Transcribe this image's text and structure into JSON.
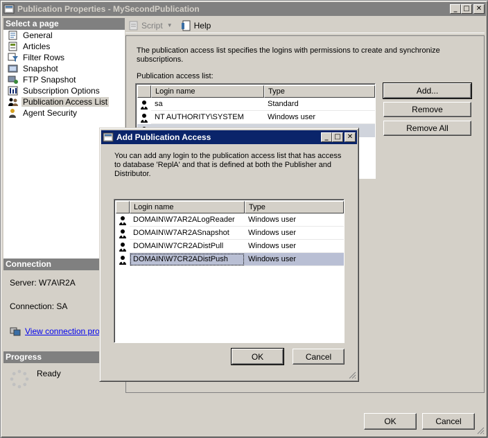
{
  "main_window": {
    "title": "Publication Properties - MySecondPublication",
    "ok_label": "OK",
    "cancel_label": "Cancel"
  },
  "left_pane": {
    "select_header": "Select a page",
    "pages": [
      {
        "label": "General",
        "icon": "general-icon"
      },
      {
        "label": "Articles",
        "icon": "articles-icon"
      },
      {
        "label": "Filter Rows",
        "icon": "filter-icon"
      },
      {
        "label": "Snapshot",
        "icon": "snapshot-icon"
      },
      {
        "label": "FTP Snapshot",
        "icon": "ftp-icon"
      },
      {
        "label": "Subscription Options",
        "icon": "options-icon"
      },
      {
        "label": "Publication Access List",
        "icon": "users-icon"
      },
      {
        "label": "Agent Security",
        "icon": "agent-icon"
      }
    ],
    "selected_page": "Publication Access List",
    "connection_header": "Connection",
    "server_text": "Server: W7A\\R2A",
    "connection_text": "Connection: SA",
    "view_link": "View connection prope",
    "progress_header": "Progress",
    "progress_status": "Ready"
  },
  "toolbar": {
    "script_label": "Script",
    "help_label": "Help"
  },
  "right_pane": {
    "description": "The publication access list specifies the logins with permissions to create and synchronize subscriptions.",
    "list_label": "Publication access list:",
    "columns": [
      "Login name",
      "Type"
    ],
    "rows": [
      {
        "login": "sa",
        "type": "Standard"
      },
      {
        "login": "NT AUTHORITY\\SYSTEM",
        "type": "Windows user"
      }
    ],
    "add_label": "Add...",
    "remove_label": "Remove",
    "remove_all_label": "Remove All"
  },
  "dialog": {
    "title": "Add Publication Access",
    "description": "You can add any login to the publication access list that has access to database 'ReplA' and that is defined at both the Publisher and Distributor.",
    "columns": [
      "Login name",
      "Type"
    ],
    "rows": [
      {
        "login": "DOMAIN\\W7AR2ALogReader",
        "type": "Windows user"
      },
      {
        "login": "DOMAIN\\W7AR2ASnapshot",
        "type": "Windows user"
      },
      {
        "login": "DOMAIN\\W7CR2ADistPull",
        "type": "Windows user"
      },
      {
        "login": "DOMAIN\\W7CR2ADistPush",
        "type": "Windows user"
      }
    ],
    "selected_row": 3,
    "ok_label": "OK",
    "cancel_label": "Cancel"
  },
  "colors": {
    "titlebar_active": "#0a246a",
    "titlebar_inactive": "#808080",
    "face": "#d4d0c8",
    "selection": "#b9bfd4"
  }
}
